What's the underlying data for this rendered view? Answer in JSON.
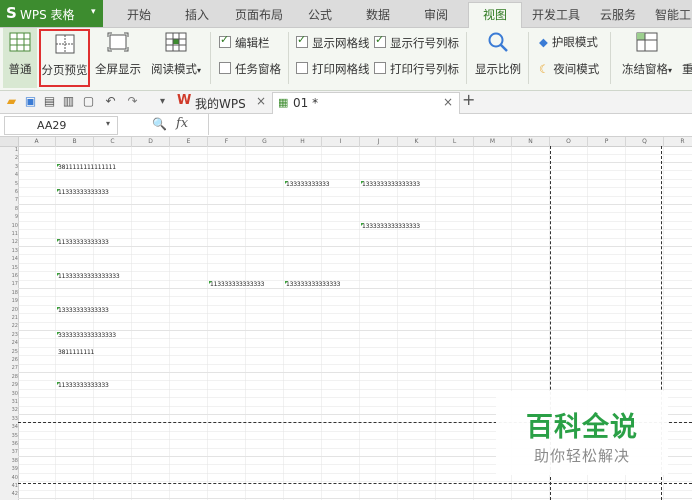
{
  "app": {
    "logo": "S",
    "title": "WPS 表格",
    "caret": "▾"
  },
  "tabs": [
    "开始",
    "插入",
    "页面布局",
    "公式",
    "数据",
    "审阅",
    "视图",
    "开发工具",
    "云服务",
    "智能工"
  ],
  "active_tab": "视图",
  "ribbon": {
    "normal": "普通",
    "page_break_preview": "分页预览",
    "full_screen": "全屏显示",
    "reading_mode": "阅读模式",
    "reading_mode_caret": "▾",
    "edit_bar": "编辑栏",
    "task_pane": "任务窗格",
    "show_gridlines": "显示网格线",
    "print_gridlines": "打印网格线",
    "show_row_col_headers": "显示行号列标",
    "print_row_col_headers": "打印行号列标",
    "zoom": "显示比例",
    "eye_protection": "护眼模式",
    "night_mode": "夜间模式",
    "freeze_panes": "冻结窗格",
    "freeze_caret": "▾",
    "more": "重"
  },
  "checks": {
    "edit_bar": true,
    "task_pane": false,
    "show_gridlines": true,
    "print_gridlines": false,
    "show_row_col_headers": true,
    "print_row_col_headers": false
  },
  "doc_tabs": [
    {
      "name": "我的WPS",
      "close": "×"
    },
    {
      "name": "01 *",
      "close": "×"
    }
  ],
  "tab_dropdown": "▾",
  "new_tab": "+",
  "formula_bar": {
    "name_box": "AA29",
    "caret": "▾",
    "fx": "fx",
    "formula": ""
  },
  "columns": [
    "A",
    "B",
    "C",
    "D",
    "E",
    "F",
    "G",
    "H",
    "I",
    "J",
    "K",
    "L",
    "M",
    "N",
    "O",
    "P",
    "Q",
    "R"
  ],
  "rows": [
    "1",
    "2",
    "3",
    "4",
    "5",
    "6",
    "7",
    "8",
    "9",
    "10",
    "11",
    "12",
    "13",
    "14",
    "15",
    "16",
    "17",
    "18",
    "19",
    "20",
    "21",
    "22",
    "23",
    "24",
    "25",
    "26",
    "27",
    "28",
    "29",
    "30",
    "31",
    "32",
    "33",
    "34",
    "35",
    "36",
    "37",
    "38",
    "39",
    "40",
    "41",
    "42"
  ],
  "cells": [
    {
      "ref": "B3",
      "text": "3811111111111111"
    },
    {
      "ref": "H5",
      "text": "133333333333"
    },
    {
      "ref": "J5",
      "text": "1333333333333333"
    },
    {
      "ref": "B6",
      "text": "11333333333333"
    },
    {
      "ref": "J10",
      "text": "1333333333333333"
    },
    {
      "ref": "B12",
      "text": "11333333333333"
    },
    {
      "ref": "B16",
      "text": "11333333333333333"
    },
    {
      "ref": "F17",
      "text": "113333333333333"
    },
    {
      "ref": "H17",
      "text": "133333333333333"
    },
    {
      "ref": "B20",
      "text": "13333333333333"
    },
    {
      "ref": "B23",
      "text": "3333333333333333"
    },
    {
      "ref": "B25",
      "text": "3811111111"
    },
    {
      "ref": "B29",
      "text": "11333333333333"
    }
  ],
  "watermark": {
    "title": "百科全说",
    "subtitle": "助你轻松解决"
  },
  "colors": {
    "brand": "#3d8c2f",
    "highlight": "#e03030",
    "watermark": "#2aa046"
  }
}
